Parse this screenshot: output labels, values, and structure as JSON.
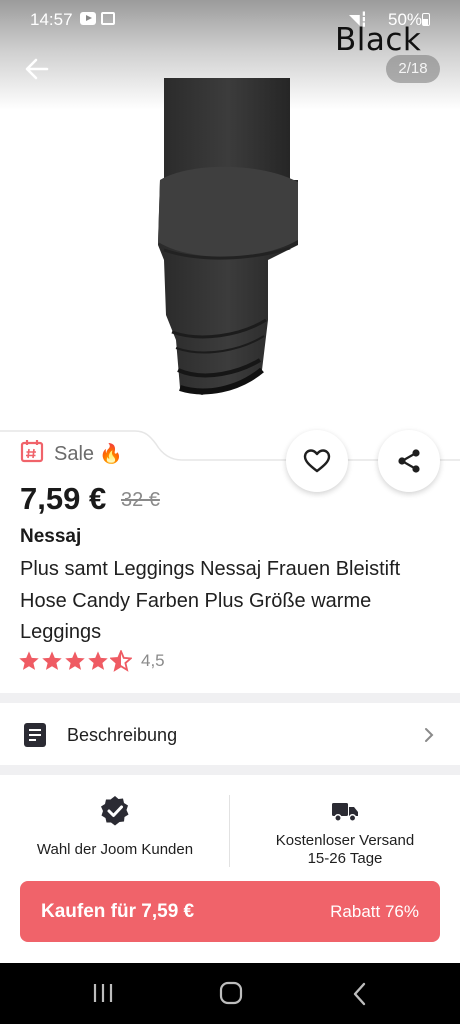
{
  "status_bar": {
    "time": "14:57",
    "battery": "50%"
  },
  "gallery": {
    "color_label": "Black",
    "counter": "2/18"
  },
  "product": {
    "sale_label": "Sale",
    "sale_emoji": "🔥",
    "price": "7,59 €",
    "old_price": "32 €",
    "brand": "Nessaj",
    "title": "Plus samt Leggings Nessaj Frauen Bleistift Hose Candy Farben Plus Größe warme Leggings",
    "rating": 4.5,
    "rating_text": "4,5"
  },
  "description": {
    "label": "Beschreibung"
  },
  "features": [
    {
      "icon": "verified-badge-icon",
      "label": "Wahl der Joom Kunden"
    },
    {
      "icon": "delivery-truck-icon",
      "label_line1": "Kostenloser Versand",
      "label_line2": "15-26 Tage"
    }
  ],
  "buy_button": {
    "label": "Kaufen für 7,59 €",
    "discount": "Rabatt 76%"
  },
  "colors": {
    "accent": "#f0636a",
    "sale_icon": "#f0636a",
    "star": "#ef5b63",
    "text": "#1f1f1f",
    "muted": "#8a8a8a"
  }
}
